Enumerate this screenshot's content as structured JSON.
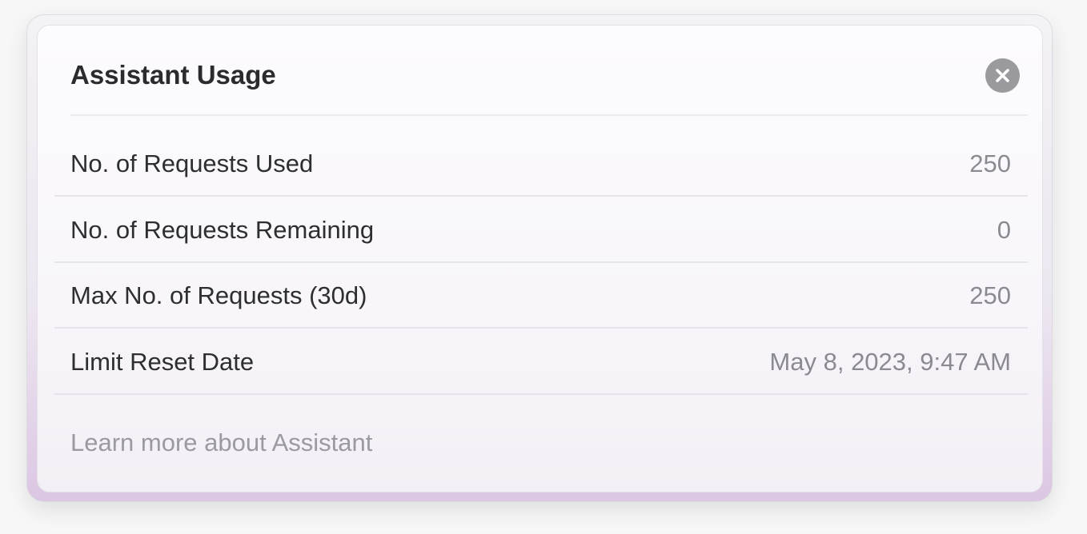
{
  "dialog": {
    "title": "Assistant Usage",
    "close_icon": "close-icon",
    "rows": [
      {
        "label": "No. of Requests Used",
        "value": "250"
      },
      {
        "label": "No. of Requests Remaining",
        "value": "0"
      },
      {
        "label": "Max No. of Requests (30d)",
        "value": "250"
      },
      {
        "label": "Limit Reset Date",
        "value": "May 8, 2023, 9:47 AM"
      }
    ],
    "learn_more_link": "Learn more about Assistant",
    "colors": {
      "title_text": "#2b2b2e",
      "value_text": "#8b8a90",
      "link_text": "#9b9aa0",
      "close_button_bg": "#9a999e",
      "accent_gradient_bottom": "#dcc6e3"
    }
  }
}
